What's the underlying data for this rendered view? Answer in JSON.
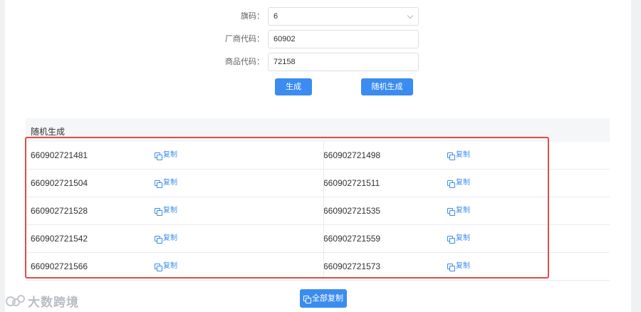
{
  "form": {
    "flag_label": "旗码：",
    "flag_value": "6",
    "maker_label": "厂商代码：",
    "maker_value": "60902",
    "product_label": "商品代码：",
    "product_value": "72158",
    "generate_label": "生成",
    "random_generate_label": "随机生成"
  },
  "section": {
    "title": "随机生成"
  },
  "rows": [
    {
      "left_code": "660902721481",
      "right_code": "660902721498"
    },
    {
      "left_code": "660902721504",
      "right_code": "660902721511"
    },
    {
      "left_code": "660902721528",
      "right_code": "660902721535"
    },
    {
      "left_code": "660902721542",
      "right_code": "660902721559"
    },
    {
      "left_code": "660902721566",
      "right_code": "660902721573"
    }
  ],
  "copy_label": "复制",
  "copy_all_label": "全部复制",
  "watermark": "大数跨境",
  "colors": {
    "primary": "#3b8cf0",
    "highlight_border": "#e04a4a"
  },
  "icons": {
    "copy": "copy-icon",
    "dropdown": "chevron-down-icon"
  }
}
